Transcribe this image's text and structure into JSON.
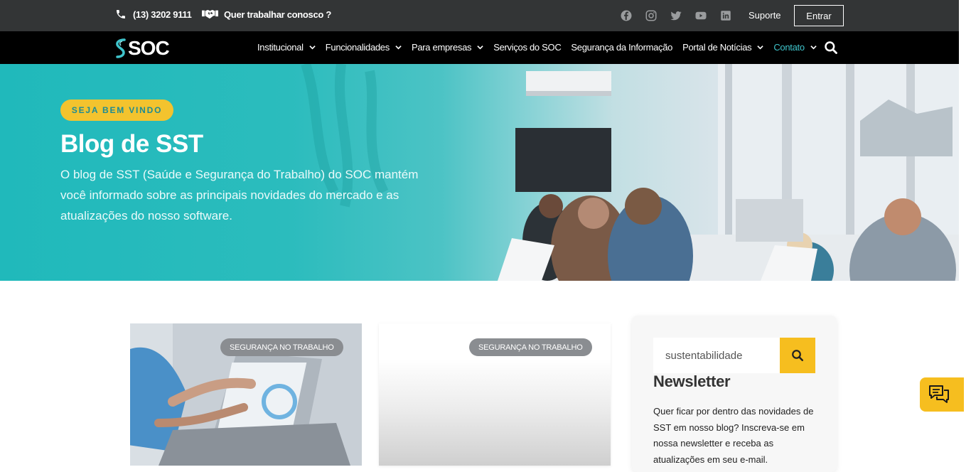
{
  "topbar": {
    "phone": "(13) 3202 9111",
    "work_link": "Quer trabalhar conosco ?",
    "socials": [
      "facebook-icon",
      "instagram-icon",
      "twitter-icon",
      "youtube-icon",
      "linkedin-icon"
    ],
    "suporte": "Suporte",
    "entrar": "Entrar"
  },
  "nav": {
    "logo": "SOC",
    "items": [
      {
        "label": "Institucional",
        "dropdown": true
      },
      {
        "label": "Funcionalidades",
        "dropdown": true
      },
      {
        "label": "Para empresas",
        "dropdown": true
      },
      {
        "label": "Serviços do SOC",
        "dropdown": false
      },
      {
        "label": "Segurança da Informação",
        "dropdown": false
      },
      {
        "label": "Portal de Notícias",
        "dropdown": true
      },
      {
        "label": "Contato",
        "dropdown": true,
        "active": true
      }
    ]
  },
  "hero": {
    "badge": "SEJA BEM VINDO",
    "title": "Blog de SST",
    "description": "O blog de SST (Saúde e Segurança do Trabalho) do SOC mantém você informado sobre as principais novidades do mercado e as atualizações do nosso software."
  },
  "cards": [
    {
      "tag": "SEGURANÇA NO TRABALHO"
    },
    {
      "tag": "SEGURANÇA NO TRABALHO"
    }
  ],
  "sidebar": {
    "search_value": "sustentabilidade",
    "newsletter_title": "Newsletter",
    "newsletter_text": "Quer ficar por dentro das novidades de SST em nosso blog? Inscreva-se em nossa newsletter e receba as atualizações em seu e-mail."
  },
  "colors": {
    "accent_teal": "#3fc4cb",
    "accent_yellow": "#f6be1f",
    "topbar": "#333536",
    "nav": "#000000"
  }
}
